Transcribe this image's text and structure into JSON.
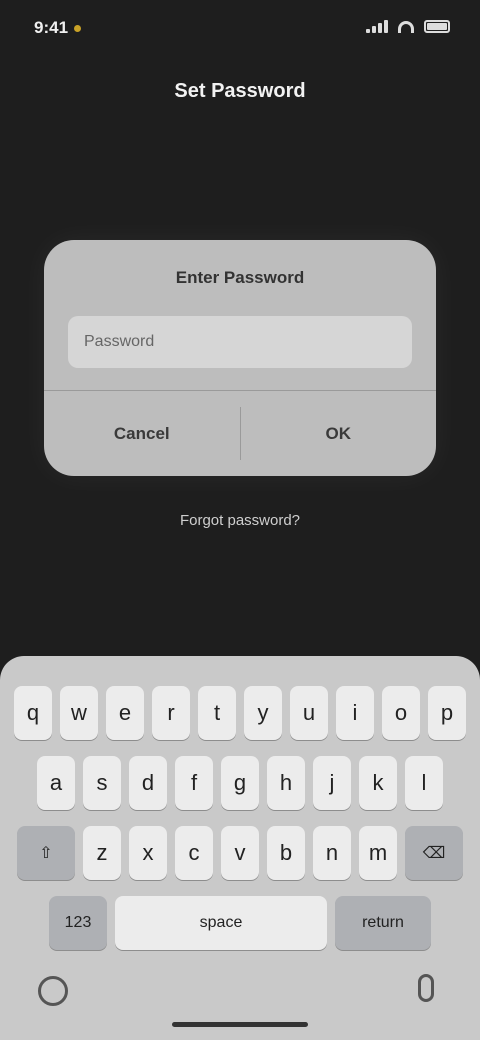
{
  "status_bar": {
    "time": "9:41",
    "accent_color": "#c9a227"
  },
  "page": {
    "title": "Set Password"
  },
  "dialog": {
    "title": "Enter Password",
    "input_placeholder": "Password",
    "input_value": "",
    "cancel_label": "Cancel",
    "ok_label": "OK"
  },
  "helper_text": "Forgot password?",
  "keyboard": {
    "row1": [
      "q",
      "w",
      "e",
      "r",
      "t",
      "y",
      "u",
      "i",
      "o",
      "p"
    ],
    "row2": [
      "a",
      "s",
      "d",
      "f",
      "g",
      "h",
      "j",
      "k",
      "l"
    ],
    "row3": [
      "z",
      "x",
      "c",
      "v",
      "b",
      "n",
      "m"
    ],
    "shift_label": "⇧",
    "delete_label": "⌫",
    "numbers_label": "123",
    "space_label": "space",
    "return_label": "return",
    "globe_icon": "globe-icon",
    "mic_icon": "microphone-icon"
  }
}
